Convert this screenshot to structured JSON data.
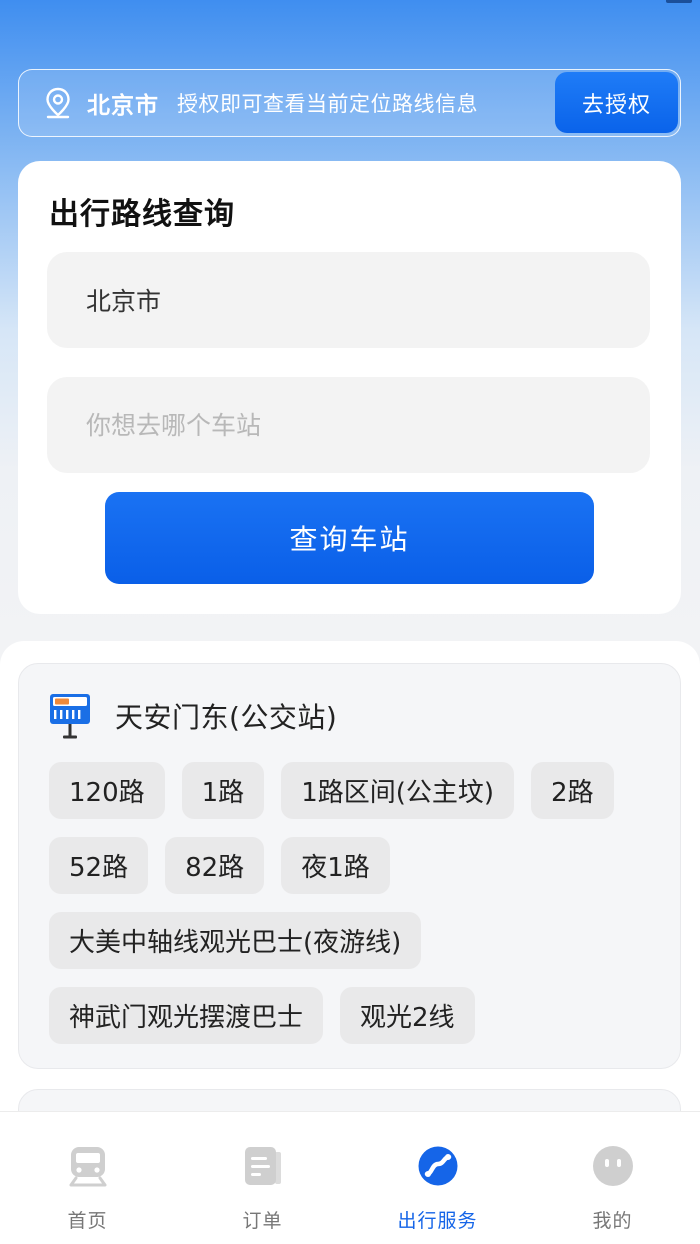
{
  "location": {
    "city": "北京市",
    "tip": "授权即可查看当前定位路线信息",
    "auth_button": "去授权"
  },
  "query": {
    "title": "出行路线查询",
    "city_value": "北京市",
    "station_placeholder": "你想去哪个车站",
    "submit_label": "查询车站"
  },
  "stations": [
    {
      "name": "天安门东(公交站)",
      "routes": [
        "120路",
        "1路",
        "1路区间(公主坟)",
        "2路",
        "52路",
        "82路",
        "夜1路",
        "大美中轴线观光巴士(夜游线)",
        "神武门观光摆渡巴士",
        "观光2线"
      ]
    }
  ],
  "tabbar": {
    "items": [
      {
        "label": "首页",
        "icon": "train-icon"
      },
      {
        "label": "订单",
        "icon": "order-doc-icon"
      },
      {
        "label": "出行服务",
        "icon": "travel-service-icon"
      },
      {
        "label": "我的",
        "icon": "profile-face-icon"
      }
    ],
    "active": "出行服务"
  },
  "colors": {
    "primary": "#0a63ea",
    "active_tab": "#1565e8",
    "inactive_icon": "#cfcfcf"
  }
}
